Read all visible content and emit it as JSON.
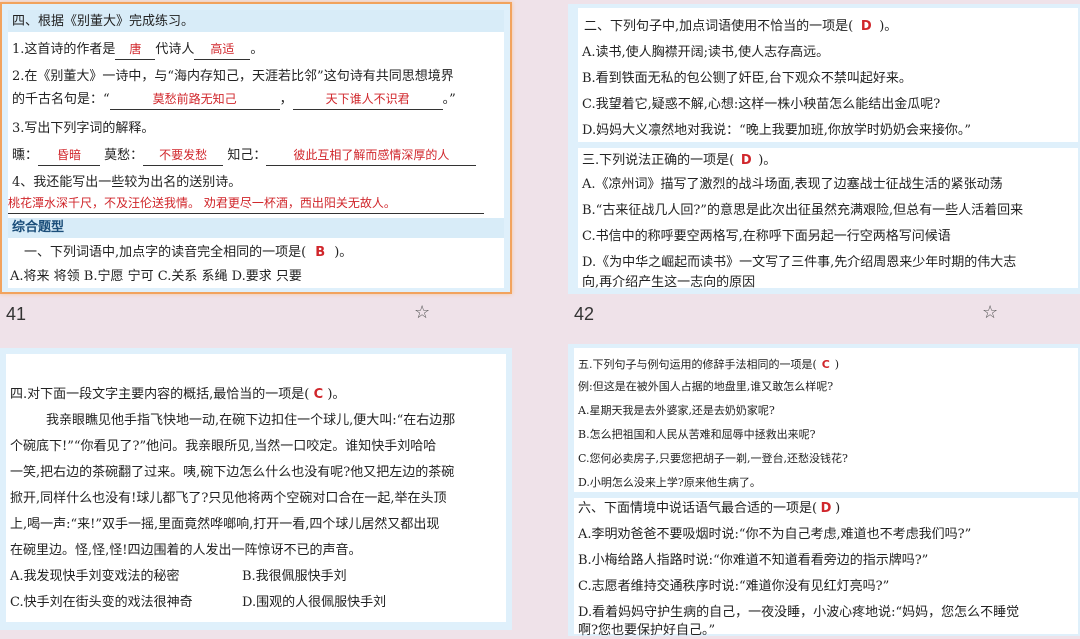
{
  "slide41": {
    "page_number": "41",
    "l1": "四、根据《别董大》完成练习。",
    "l2a": "1.这首诗的作者是",
    "l2_ans1": "唐",
    "l2b": "代诗人",
    "l2_ans2": "高适",
    "l2c": "。",
    "l3": "2.在《别董大》一诗中，与“海内存知己，天涯若比邻”这句诗有共同思想境界",
    "l4a": "的千古名句是：“",
    "l4_ans1": "莫愁前路无知己",
    "l4b": "，",
    "l4_ans2": "天下谁人不识君",
    "l4c": "。”",
    "l5": "3.写出下列字词的解释。",
    "l6a": "曛：",
    "l6_ans1": "昏暗",
    "l6b": "莫愁：",
    "l6_ans2": "不要发愁",
    "l6c": "知己：",
    "l6_ans3": "彼此互相了解而感情深厚的人",
    "l7": "4、我还能写出一些较为出名的送别诗。",
    "l8_ans": "桃花潭水深千尺，不及汪伦送我情。  劝君更尽一杯酒，西出阳关无故人。",
    "section": "综合题型",
    "q1a": "一、下列词语中,加点字的读音完全相同的一项是(",
    "q1_ans": "B",
    "q1b": ")。",
    "q1_opts": "A.将来 将领  B.宁愿 宁可  C.关系 系绳  D.要求 只要"
  },
  "slide42": {
    "page_number": "42",
    "q2a": "二、下列句子中,加点词语使用不恰当的一项是(",
    "q2_ans": "D",
    "q2b": ")。",
    "q2_A": "A.读书,使人胸襟开阔;读书,使人志存高远。",
    "q2_B": "B.看到铁面无私的包公铡了奸臣,台下观众不禁叫起好来。",
    "q2_C": "C.我望着它,疑惑不解,心想:这样一株小秧苗怎么能结出金瓜呢?",
    "q2_D": "D.妈妈大义凛然地对我说：“晚上我要加班,你放学时奶奶会来接你。”",
    "q3a": "三.下列说法正确的一项是(",
    "q3_ans": "D",
    "q3b": ")。",
    "q3_A": "A.《凉州词》描写了激烈的战斗场面,表现了边塞战士征战生活的紧张动荡",
    "q3_B": "B.“古来征战几人回?”的意思是此次出征虽然充满艰险,但总有一些人活着回来",
    "q3_C": "C.书信中的称呼要空两格写,在称呼下面另起一行空两格写问候语",
    "q3_D1": "D.《为中华之崛起而读书》一文写了三件事,先介绍周恩来少年时期的伟大志",
    "q3_D2": "向,再介绍产生这一志向的原因"
  },
  "slide_bl": {
    "q4a": "四.对下面一段文字主要内容的概括,最恰当的一项是(",
    "q4_ans": "C",
    "q4b": ")。",
    "p1": "我亲眼瞧见他手指飞快地一动,在碗下边扣住一个球儿,便大叫:“在右边那",
    "p2": "个碗底下!”“你看见了?”他问。我亲眼所见,当然一口咬定。谁知快手刘哈哈",
    "p3": "一笑,把右边的茶碗翻了过来。咦,碗下边怎么什么也没有呢?他又把左边的茶碗",
    "p4": "掀开,同样什么也没有!球儿都飞了?只见他将两个空碗对口合在一起,举在头顶",
    "p5": "上,喝一声:“来!”双手一摇,里面竟然哗啷响,打开一看,四个球儿居然又都出现",
    "p6": "在碗里边。怪,怪,怪!四边围着的人发出一阵惊讶不已的声音。",
    "optA": "A.我发现快手刘变戏法的秘密",
    "optB": "B.我很佩服快手刘",
    "optC": "C.快手刘在街头变的戏法很神奇",
    "optD": "D.围观的人很佩服快手刘"
  },
  "slide_br": {
    "q5a": "五.下列句子与例句运用的修辞手法相同的一项是(",
    "q5_ans": "C",
    "q5b": ")",
    "q5_ex": "例:但这是在被外国人占据的地盘里,谁又敢怎么样呢?",
    "q5_A": "A.星期天我是去外婆家,还是去奶奶家呢?",
    "q5_B": "B.怎么把祖国和人民从苦难和屈辱中拯救出来呢?",
    "q5_C": "C.您何必卖房子,只要您把胡子一剃,一登台,还愁没钱花?",
    "q5_D": "D.小明怎么没来上学?原来他生病了。",
    "q6a": "六、下面情境中说话语气最合适的一项是(",
    "q6_ans": "D",
    "q6b": ")",
    "q6_A": "A.李明劝爸爸不要吸烟时说:“你不为自己考虑,难道也不考虑我们吗?”",
    "q6_B": "B.小梅给路人指路时说:“你难道不知道看看旁边的指示牌吗?”",
    "q6_C": "C.志愿者维持交通秩序时说:“难道你没有见红灯亮吗?”",
    "q6_D1": "D.看着妈妈守护生病的自己，一夜没睡，小波心疼地说:“妈妈，您怎么不睡觉",
    "q6_D2": "啊?您也要保护好自己。”"
  },
  "icons": {
    "star1": "star-outline-icon",
    "star2": "star-outline-icon"
  },
  "colors": {
    "accent_red": "#d0262b",
    "selected_border": "#f2a35e",
    "slide_bg": "#dff0fb"
  }
}
